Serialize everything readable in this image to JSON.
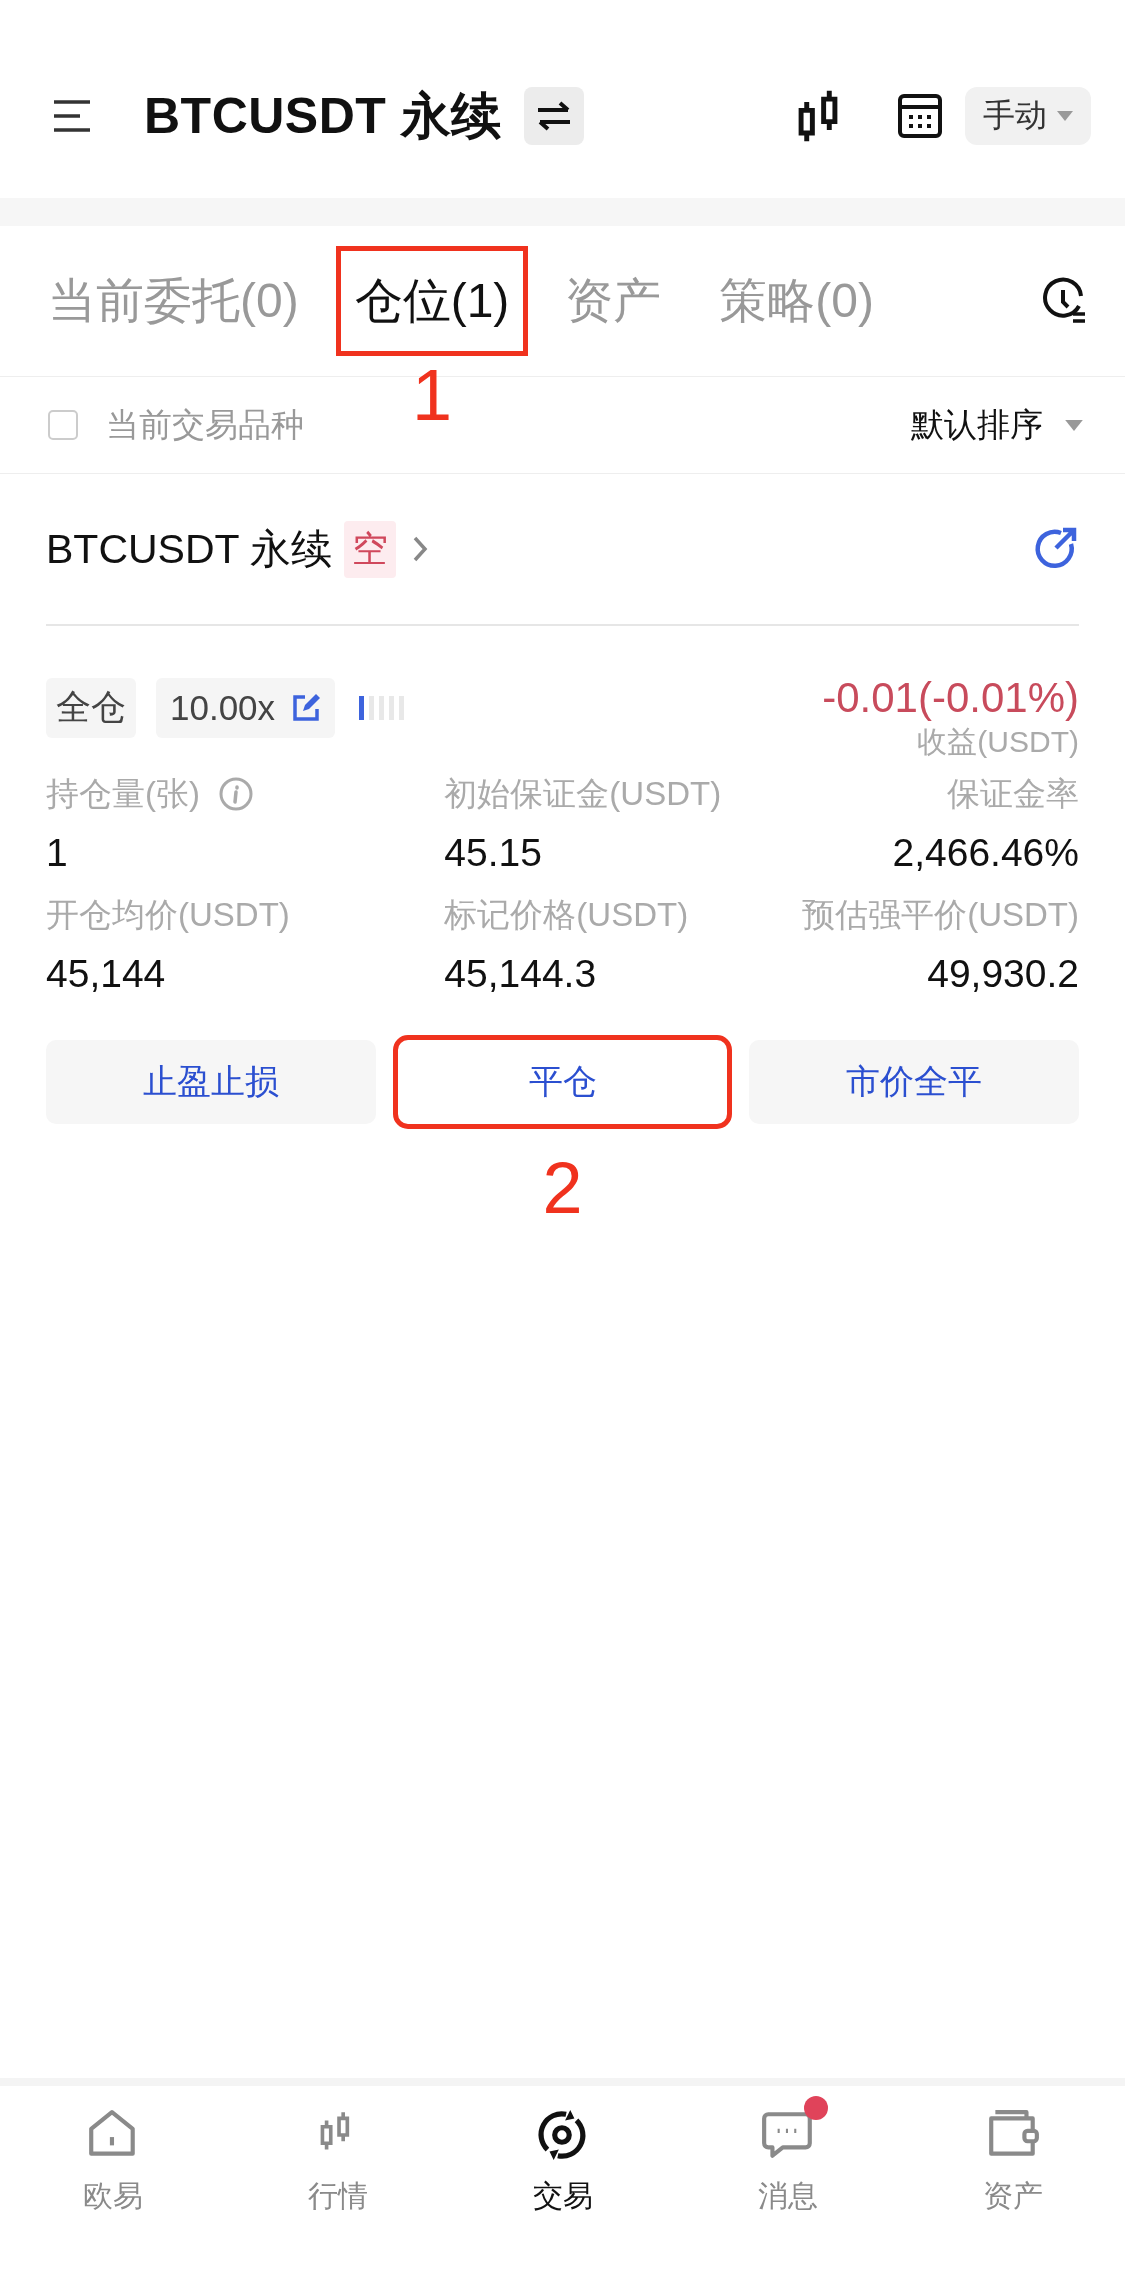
{
  "header": {
    "title": "BTCUSDT 永续",
    "mode": "手动"
  },
  "tabs": [
    {
      "label": "当前委托(0)",
      "selected": false
    },
    {
      "label": "仓位(1)",
      "selected": true,
      "callout": "1"
    },
    {
      "label": "资产",
      "selected": false
    },
    {
      "label": "策略(0)",
      "selected": false
    }
  ],
  "filter": {
    "label": "当前交易品种",
    "checked": false,
    "sort": "默认排序"
  },
  "position": {
    "title": "BTCUSDT 永续",
    "side": "空",
    "margin_mode": "全仓",
    "leverage": "10.00x",
    "pnl": "-0.01(-0.01%)",
    "pnl_label": "收益(USDT)",
    "fields": [
      {
        "label": "持仓量(张)",
        "value": "1",
        "info": true
      },
      {
        "label": "初始保证金(USDT)",
        "value": "45.15"
      },
      {
        "label": "保证金率",
        "value": "2,466.46%"
      },
      {
        "label": "开仓均价(USDT)",
        "value": "45,144"
      },
      {
        "label": "标记价格(USDT)",
        "value": "45,144.3"
      },
      {
        "label": "预估强平价(USDT)",
        "value": "49,930.2"
      }
    ],
    "buttons": [
      {
        "label": "止盈止损"
      },
      {
        "label": "平仓",
        "callout": "2"
      },
      {
        "label": "市价全平"
      }
    ]
  },
  "nav": [
    {
      "label": "欧易",
      "selected": false
    },
    {
      "label": "行情",
      "selected": false
    },
    {
      "label": "交易",
      "selected": true
    },
    {
      "label": "消息",
      "selected": false,
      "badge": true
    },
    {
      "label": "资产",
      "selected": false
    }
  ]
}
